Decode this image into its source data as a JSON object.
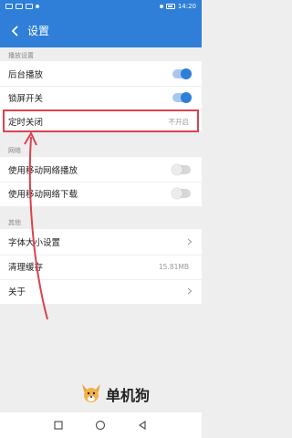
{
  "statusbar": {
    "time": "14:20"
  },
  "header": {
    "title": "设置",
    "back_icon": "chevron-left-icon"
  },
  "sections": {
    "playback": {
      "label": "播放设置",
      "items": [
        {
          "label": "后台播放",
          "toggle": "on"
        },
        {
          "label": "锁屏开关",
          "toggle": "on"
        },
        {
          "label": "定时关闭",
          "value": "不开启"
        }
      ]
    },
    "network": {
      "label": "网络",
      "items": [
        {
          "label": "使用移动网络播放",
          "toggle": "off"
        },
        {
          "label": "使用移动网络下载",
          "toggle": "off"
        }
      ]
    },
    "other": {
      "label": "其他",
      "items": [
        {
          "label": "字体大小设置"
        },
        {
          "label": "清理缓存",
          "value": "15.81MB"
        },
        {
          "label": "关于"
        }
      ]
    }
  },
  "watermark": {
    "text": "单机狗"
  },
  "colors": {
    "accent": "#2f7fd8",
    "highlight": "#d9434e"
  }
}
